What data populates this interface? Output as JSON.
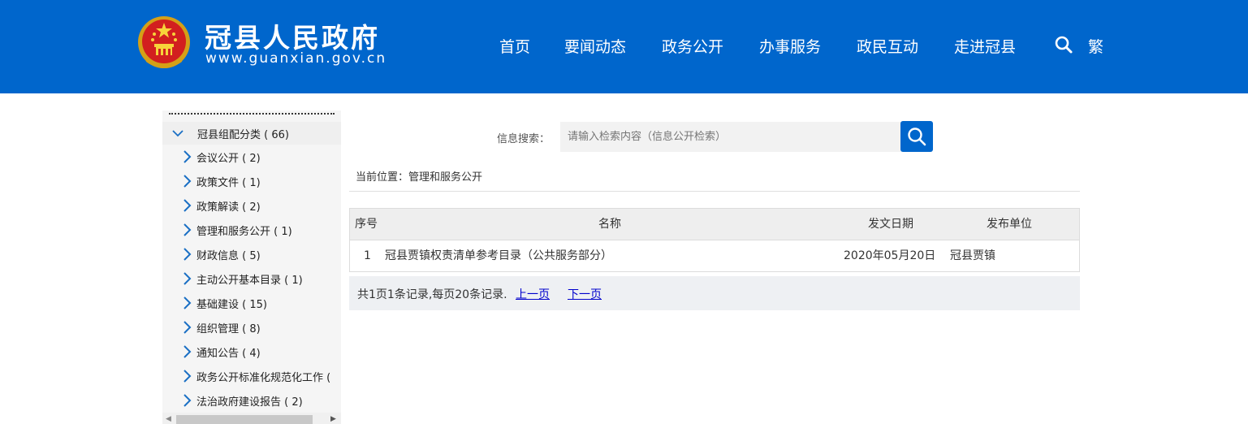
{
  "header": {
    "site_title": "冠县人民政府",
    "site_url": "www.guanxian.gov.cn",
    "nav": [
      "首页",
      "要闻动态",
      "政务公开",
      "办事服务",
      "政民互动",
      "走进冠县"
    ],
    "traditional_label": "繁",
    "background_color": "#0066cc"
  },
  "sidebar": {
    "root": "冠县组配分类 ( 66)",
    "items": [
      "会议公开 ( 2)",
      "政策文件 ( 1)",
      "政策解读 ( 2)",
      "管理和服务公开 ( 1)",
      "财政信息 ( 5)",
      "主动公开基本目录 ( 1)",
      "基础建设 ( 15)",
      "组织管理 ( 8)",
      "通知公告 ( 4)",
      "政务公开标准化规范化工作 (",
      "法治政府建设报告 ( 2)"
    ]
  },
  "search": {
    "label": "信息搜索：",
    "placeholder": "请输入检索内容（信息公开检索）"
  },
  "breadcrumb": "当前位置：管理和服务公开",
  "table": {
    "headers": {
      "index": "序号",
      "name": "名称",
      "date": "发文日期",
      "unit": "发布单位"
    },
    "rows": [
      {
        "index": "1",
        "name": "冠县贾镇权责清单参考目录（公共服务部分）",
        "date": "2020年05月20日",
        "unit": "冠县贾镇"
      }
    ]
  },
  "pager": {
    "info": "共1页1条记录,每页20条记录.",
    "prev": "上一页",
    "next": "下一页"
  }
}
